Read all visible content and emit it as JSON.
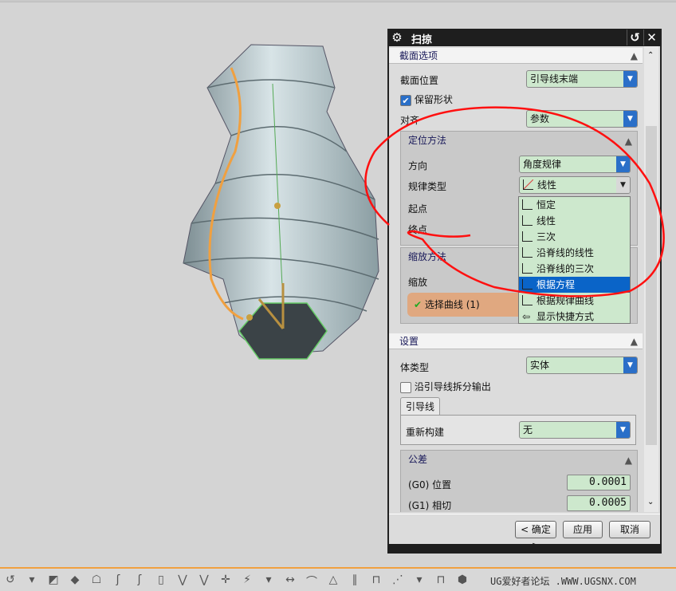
{
  "dialog": {
    "title": "扫掠",
    "section_options": {
      "header": "截面选项",
      "section_position": {
        "label": "截面位置",
        "value": "引导线末端"
      },
      "keep_shape": {
        "label": "保留形状",
        "checked": true
      },
      "align": {
        "label": "对齐",
        "value": "参数"
      }
    },
    "orientation": {
      "header": "定位方法",
      "direction": {
        "label": "方向",
        "value": "角度规律"
      },
      "law_type": {
        "label": "规律类型",
        "value": "线性"
      },
      "start": "起点",
      "end": "终点"
    },
    "law_menu": [
      "恒定",
      "线性",
      "三次",
      "沿脊线的线性",
      "沿脊线的三次",
      "根据方程",
      "根据规律曲线",
      "显示快捷方式"
    ],
    "law_menu_highlighted": "根据方程",
    "scaling": {
      "header": "缩放方法",
      "scale_label": "缩放",
      "select_curve": "选择曲线 (1)"
    },
    "settings": {
      "header": "设置",
      "body_type": {
        "label": "体类型",
        "value": "实体"
      },
      "split_output": {
        "label": "沿引导线拆分输出",
        "checked": false
      },
      "tab": "引导线",
      "rebuild": {
        "label": "重新构建",
        "value": "无"
      }
    },
    "tolerance": {
      "header": "公差",
      "g0": {
        "label": "(G0) 位置",
        "value": "0.0001"
      },
      "g1": {
        "label": "(G1) 相切",
        "value": "0.0005"
      }
    },
    "buttons": {
      "ok": "< 确定 >",
      "apply": "应用",
      "cancel": "取消"
    }
  },
  "watermark": "UG爱好者论坛 .WWW.UGSNX.COM",
  "colors": {
    "field": "#cde8cd",
    "accent": "#0a64c8",
    "annotation": "#ff0000",
    "guide": "#f0a040"
  }
}
